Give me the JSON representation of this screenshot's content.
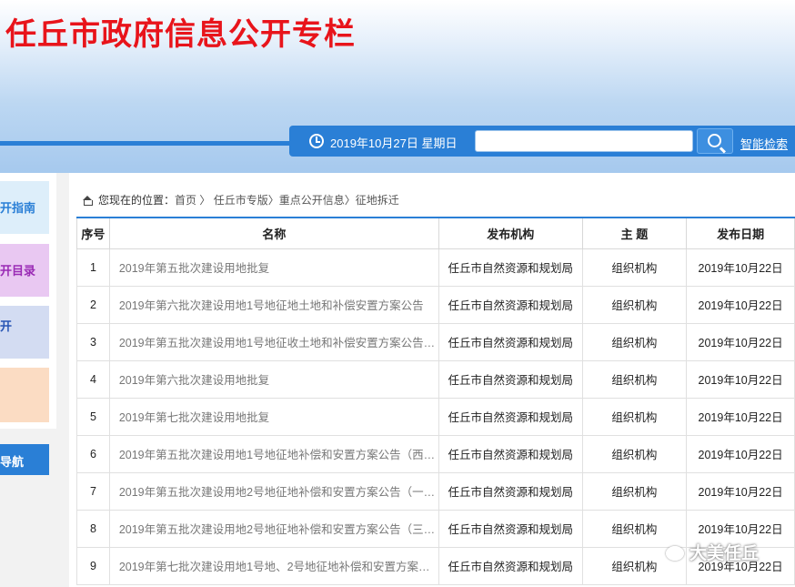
{
  "header": {
    "title": "任丘市政府信息公开专栏",
    "date": "2019年10月27日 星期日",
    "search_placeholder": "",
    "smart_search": "智能检索",
    "clock_icon": "clock-icon",
    "search_icon": "search-icon"
  },
  "sidebar": {
    "items": [
      {
        "label": "开指南"
      },
      {
        "label": "开目录"
      },
      {
        "label": "开"
      },
      {
        "label": ""
      }
    ],
    "nav_label": "导航"
  },
  "breadcrumb": {
    "prefix": "您现在的位置：",
    "items": [
      "首页",
      "任丘市专版",
      "重点公开信息",
      "征地拆迁"
    ],
    "sep1": " 〉",
    "sep2": "〉",
    "sep3": "〉"
  },
  "table": {
    "headers": [
      "序号",
      "名称",
      "发布机构",
      "主 题",
      "发布日期"
    ],
    "rows": [
      {
        "no": "1",
        "name": "2019年第五批次建设用地批复",
        "org": "任丘市自然资源和规划局",
        "topic": "组织机构",
        "date": "2019年10月22日"
      },
      {
        "no": "2",
        "name": "2019年第六批次建设用地1号地征地土地和补偿安置方案公告",
        "org": "任丘市自然资源和规划局",
        "topic": "组织机构",
        "date": "2019年10月22日"
      },
      {
        "no": "3",
        "name": "2019年第五批次建设用地1号地征收土地和补偿安置方案公告（…",
        "org": "任丘市自然资源和规划局",
        "topic": "组织机构",
        "date": "2019年10月22日"
      },
      {
        "no": "4",
        "name": "2019年第六批次建设用地批复",
        "org": "任丘市自然资源和规划局",
        "topic": "组织机构",
        "date": "2019年10月22日"
      },
      {
        "no": "5",
        "name": "2019年第七批次建设用地批复",
        "org": "任丘市自然资源和规划局",
        "topic": "组织机构",
        "date": "2019年10月22日"
      },
      {
        "no": "6",
        "name": "2019年第五批次建设用地1号地征地补偿和安置方案公告（西凉…",
        "org": "任丘市自然资源和规划局",
        "topic": "组织机构",
        "date": "2019年10月22日"
      },
      {
        "no": "7",
        "name": "2019年第五批次建设用地2号地征地补偿和安置方案公告（一街…",
        "org": "任丘市自然资源和规划局",
        "topic": "组织机构",
        "date": "2019年10月22日"
      },
      {
        "no": "8",
        "name": "2019年第五批次建设用地2号地征地补偿和安置方案公告（三街…",
        "org": "任丘市自然资源和规划局",
        "topic": "组织机构",
        "date": "2019年10月22日"
      },
      {
        "no": "9",
        "name": "2019年第七批次建设用地1号地、2号地征地补偿和安置方案公告",
        "org": "任丘市自然资源和规划局",
        "topic": "组织机构",
        "date": "2019年10月22日"
      }
    ]
  },
  "watermark": "大美任丘"
}
